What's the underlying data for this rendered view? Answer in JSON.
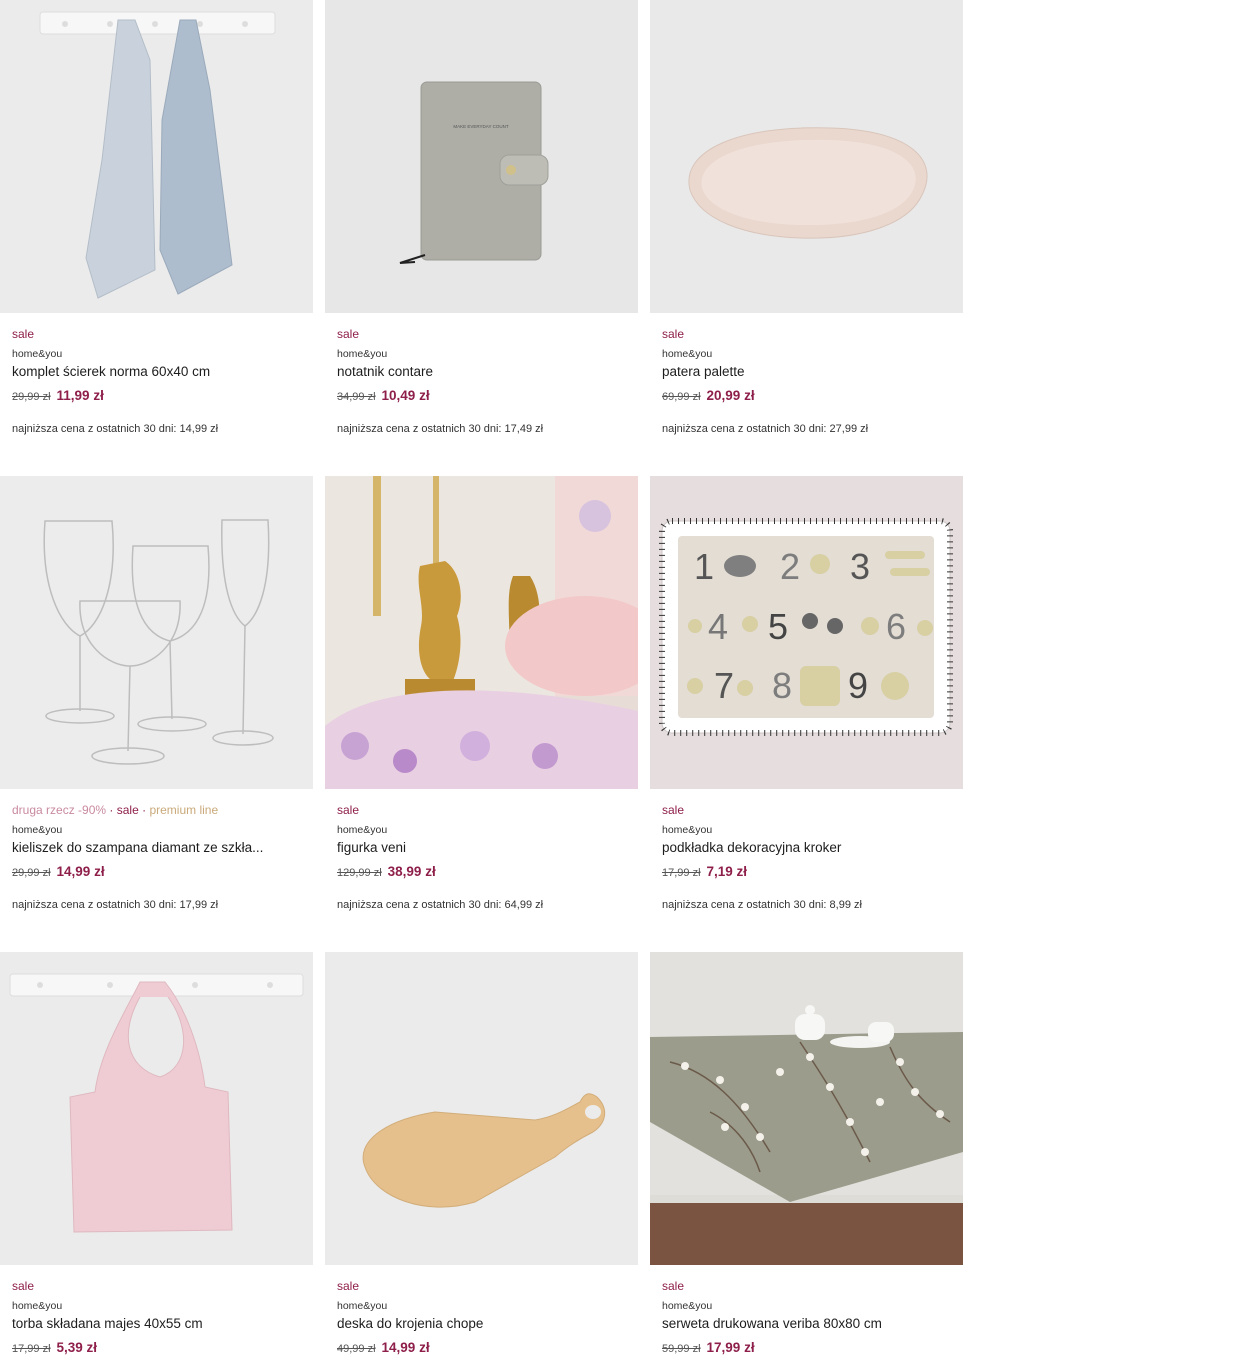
{
  "products": [
    {
      "tags": [
        "sale"
      ],
      "brand": "home&you",
      "name": "komplet ścierek norma 60x40 cm",
      "old_price": "29,99 zł",
      "new_price": "11,99 zł",
      "lowest_price": "najniższa cena z ostatnich 30 dni: 14,99 zł"
    },
    {
      "tags": [
        "sale"
      ],
      "brand": "home&you",
      "name": "notatnik contare",
      "old_price": "34,99 zł",
      "new_price": "10,49 zł",
      "lowest_price": "najniższa cena z ostatnich 30 dni: 17,49 zł"
    },
    {
      "tags": [
        "sale"
      ],
      "brand": "home&you",
      "name": "patera palette",
      "old_price": "69,99 zł",
      "new_price": "20,99 zł",
      "lowest_price": "najniższa cena z ostatnich 30 dni: 27,99 zł"
    },
    {
      "tags": [
        "druga rzecz -90%",
        "sale",
        "premium line"
      ],
      "brand": "home&you",
      "name": "kieliszek do szampana diamant ze szkła...",
      "old_price": "29,99 zł",
      "new_price": "14,99 zł",
      "lowest_price": "najniższa cena z ostatnich 30 dni: 17,99 zł"
    },
    {
      "tags": [
        "sale"
      ],
      "brand": "home&you",
      "name": "figurka veni",
      "old_price": "129,99 zł",
      "new_price": "38,99 zł",
      "lowest_price": "najniższa cena z ostatnich 30 dni: 64,99 zł"
    },
    {
      "tags": [
        "sale"
      ],
      "brand": "home&you",
      "name": "podkładka dekoracyjna kroker",
      "old_price": "17,99 zł",
      "new_price": "7,19 zł",
      "lowest_price": "najniższa cena z ostatnich 30 dni: 8,99 zł"
    },
    {
      "tags": [
        "sale"
      ],
      "brand": "home&you",
      "name": "torba składana majes 40x55 cm",
      "old_price": "17,99 zł",
      "new_price": "5,39 zł",
      "lowest_price": ""
    },
    {
      "tags": [
        "sale"
      ],
      "brand": "home&you",
      "name": "deska do krojenia chope",
      "old_price": "49,99 zł",
      "new_price": "14,99 zł",
      "lowest_price": ""
    },
    {
      "tags": [
        "sale"
      ],
      "brand": "home&you",
      "name": "serweta drukowana veriba 80x80 cm",
      "old_price": "59,99 zł",
      "new_price": "17,99 zł",
      "lowest_price": ""
    }
  ],
  "placemat_numbers": [
    "1",
    "2",
    "3",
    "4",
    "5",
    "6",
    "7",
    "8",
    "9"
  ],
  "notebook_text": "MAKE EVERYDAY COUNT",
  "colors": {
    "sale": "#8e1f4a",
    "promo": "#c98aa0",
    "premium": "#caa97a"
  }
}
